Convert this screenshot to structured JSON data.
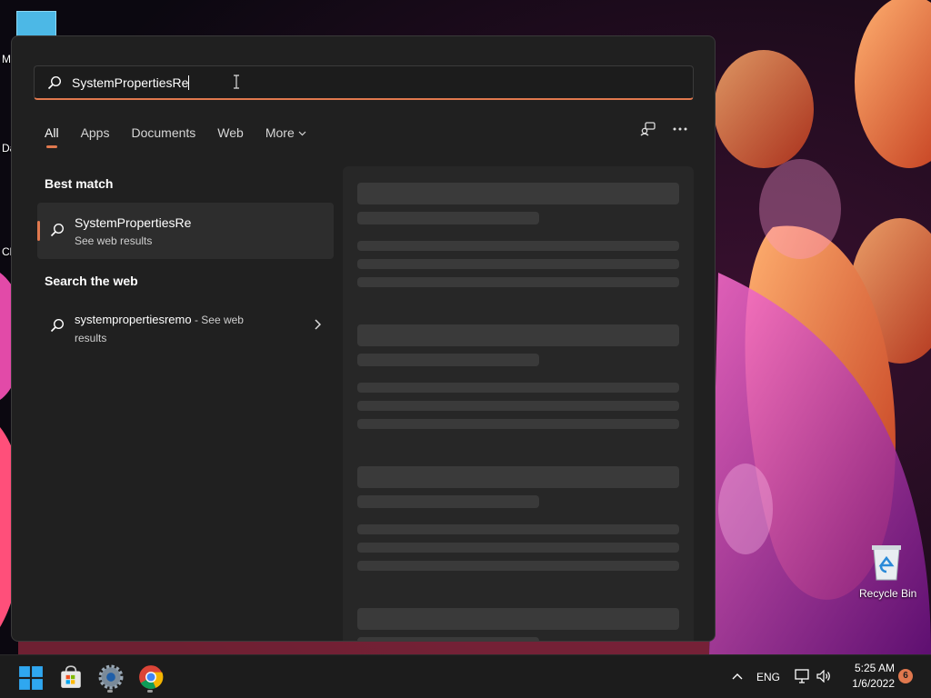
{
  "desktop": {
    "edge_labels": [
      "M",
      "Da",
      "Cl"
    ],
    "recycle_bin_label": "Recycle Bin"
  },
  "search": {
    "query": "SystemPropertiesRe",
    "tabs": [
      "All",
      "Apps",
      "Documents",
      "Web",
      "More"
    ],
    "active_tab": "All",
    "best_match": {
      "heading": "Best match",
      "title": "SystemPropertiesRe",
      "subtitle": "See web results"
    },
    "search_web": {
      "heading": "Search the web",
      "term": "systempropertiesremo",
      "separator": " - ",
      "suffix": "See web results"
    },
    "icons": [
      "search-icon",
      "share-device-icon",
      "more-options-icon",
      "chevron-right-icon"
    ]
  },
  "taskbar": {
    "apps": [
      "start-icon",
      "store-icon",
      "settings-icon",
      "chrome-icon"
    ],
    "language": "ENG",
    "time": "5:25 AM",
    "date": "1/6/2022",
    "notification_count": "6"
  },
  "colors": {
    "accent": "#e0784e",
    "panel": "#202020",
    "taskbar": "#1c1c1c"
  }
}
